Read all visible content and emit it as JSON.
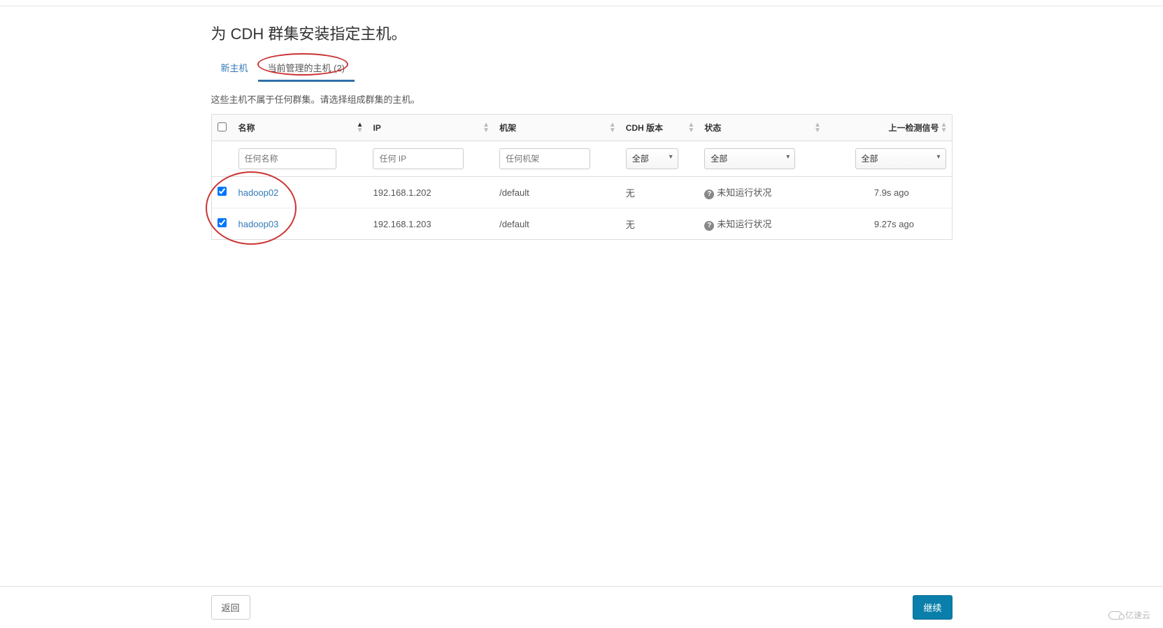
{
  "page": {
    "title": "为 CDH 群集安装指定主机。",
    "subtitle": "这些主机不属于任何群集。请选择组成群集的主机。"
  },
  "tabs": {
    "new_hosts": "新主机",
    "managed_hosts": "当前管理的主机 (2)"
  },
  "columns": {
    "name": "名称",
    "ip": "IP",
    "rack": "机架",
    "cdh_version": "CDH 版本",
    "status": "状态",
    "last_signal": "上一检测信号"
  },
  "filters": {
    "name_placeholder": "任何名称",
    "ip_placeholder": "任何 IP",
    "rack_placeholder": "任何机架",
    "version_all": "全部",
    "status_all": "全部",
    "signal_all": "全部"
  },
  "rows": [
    {
      "checked": true,
      "name": "hadoop02",
      "ip": "192.168.1.202",
      "rack": "/default",
      "cdh_version": "无",
      "status": "未知运行状况",
      "last_signal": "7.9s ago"
    },
    {
      "checked": true,
      "name": "hadoop03",
      "ip": "192.168.1.203",
      "rack": "/default",
      "cdh_version": "无",
      "status": "未知运行状况",
      "last_signal": "9.27s ago"
    }
  ],
  "buttons": {
    "back": "返回",
    "continue": "继续"
  },
  "watermark": "亿速云"
}
